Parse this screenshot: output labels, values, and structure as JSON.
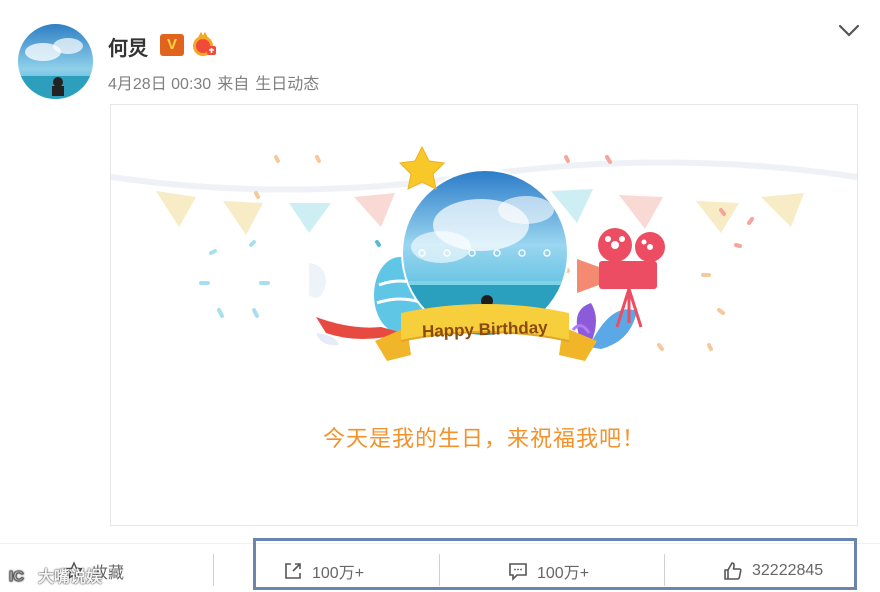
{
  "post": {
    "author": {
      "name": "何炅",
      "badge_letter": "V"
    },
    "meta": {
      "date": "4月28日 00:30",
      "source_prefix": "来自",
      "source": "生日动态"
    }
  },
  "card": {
    "banner_text": "Happy Birthday",
    "message": "今天是我的生日，来祝福我吧！"
  },
  "actions": {
    "favorite_label": "收藏",
    "share_count": "100万+",
    "comment_count": "100万+",
    "like_count": "32222845"
  },
  "watermark": {
    "text": "大嘴说娱"
  },
  "icons": {
    "chevron": "chevron-down-icon",
    "favorite": "star-outline-icon",
    "share": "share-icon",
    "comment": "comment-icon",
    "like": "thumbs-up-icon"
  },
  "colors": {
    "message": "#f3922a",
    "banner_ribbon": "#f7c434",
    "verified_badge": "#e0641e",
    "highlight_border": "#6a86ad"
  }
}
